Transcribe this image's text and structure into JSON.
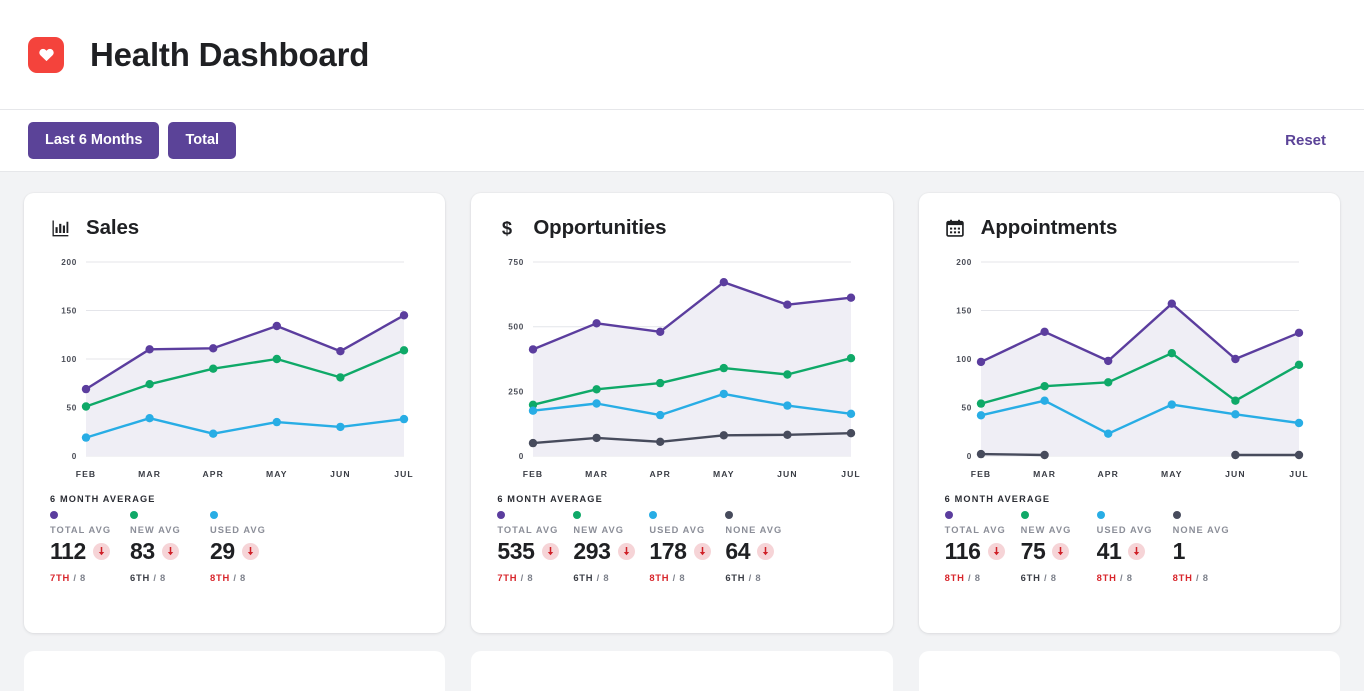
{
  "header": {
    "logo_icon": "heart-icon",
    "logo_color": "#f4433c",
    "title": "Health Dashboard"
  },
  "toolbar": {
    "filters": [
      {
        "label": "Last 6 Months",
        "active": true
      },
      {
        "label": "Total",
        "active": true
      }
    ],
    "reset_label": "Reset",
    "accent_color": "#5b4398"
  },
  "series_colors": {
    "total": "#5b3d9e",
    "new": "#0fa968",
    "used": "#28ade5",
    "none": "#474b5c"
  },
  "cards": [
    {
      "id": "sales",
      "icon": "bar-chart-icon",
      "title": "Sales",
      "stats_caption": "6 MONTH AVERAGE",
      "stats": [
        {
          "label": "TOTAL AVG",
          "value": "112",
          "color": "#5b3d9e",
          "trend": "down",
          "rank": "7TH",
          "rank_bad": true,
          "rank_total": "/ 8"
        },
        {
          "label": "NEW AVG",
          "value": "83",
          "color": "#0fa968",
          "trend": "down",
          "rank": "6TH",
          "rank_bad": false,
          "rank_total": "/ 8"
        },
        {
          "label": "USED AVG",
          "value": "29",
          "color": "#28ade5",
          "trend": "down",
          "rank": "8TH",
          "rank_bad": true,
          "rank_total": "/ 8"
        }
      ],
      "chart_data": {
        "type": "line",
        "title": "Sales",
        "xlabel": "",
        "ylabel": "",
        "x": [
          "FEB",
          "MAR",
          "APR",
          "MAY",
          "JUN",
          "JUL"
        ],
        "categories": [
          "FEB",
          "MAR",
          "APR",
          "MAY",
          "JUN",
          "JUL"
        ],
        "yticks": [
          0,
          50,
          100,
          150,
          200
        ],
        "ylim": [
          0,
          200
        ],
        "grid": true,
        "legend": "bottom",
        "series": [
          {
            "name": "TOTAL AVG",
            "color": "#5b3d9e",
            "values": [
              69,
              110,
              111,
              134,
              108,
              145
            ]
          },
          {
            "name": "NEW AVG",
            "color": "#0fa968",
            "values": [
              51,
              74,
              90,
              100,
              81,
              109
            ]
          },
          {
            "name": "USED AVG",
            "color": "#28ade5",
            "values": [
              19,
              39,
              23,
              35,
              30,
              38
            ]
          }
        ]
      }
    },
    {
      "id": "opportunities",
      "icon": "dollar-icon",
      "title": "Opportunities",
      "stats_caption": "6 MONTH AVERAGE",
      "stats": [
        {
          "label": "TOTAL AVG",
          "value": "535",
          "color": "#5b3d9e",
          "trend": "down",
          "rank": "7TH",
          "rank_bad": true,
          "rank_total": "/ 8"
        },
        {
          "label": "NEW AVG",
          "value": "293",
          "color": "#0fa968",
          "trend": "down",
          "rank": "6TH",
          "rank_bad": false,
          "rank_total": "/ 8"
        },
        {
          "label": "USED AVG",
          "value": "178",
          "color": "#28ade5",
          "trend": "down",
          "rank": "8TH",
          "rank_bad": true,
          "rank_total": "/ 8"
        },
        {
          "label": "NONE AVG",
          "value": "64",
          "color": "#474b5c",
          "trend": "down",
          "rank": "6TH",
          "rank_bad": false,
          "rank_total": "/ 8"
        }
      ],
      "chart_data": {
        "type": "line",
        "title": "Opportunities",
        "xlabel": "",
        "ylabel": "",
        "x": [
          "FEB",
          "MAR",
          "APR",
          "MAY",
          "JUN",
          "JUL"
        ],
        "categories": [
          "FEB",
          "MAR",
          "APR",
          "MAY",
          "JUN",
          "JUL"
        ],
        "yticks": [
          0,
          250,
          500,
          750
        ],
        "ylim": [
          0,
          750
        ],
        "grid": true,
        "legend": "bottom",
        "series": [
          {
            "name": "TOTAL AVG",
            "color": "#5b3d9e",
            "values": [
              412,
              513,
              480,
              672,
              585,
              612
            ]
          },
          {
            "name": "NEW AVG",
            "color": "#0fa968",
            "values": [
              198,
              258,
              282,
              340,
              315,
              378
            ]
          },
          {
            "name": "USED AVG",
            "color": "#28ade5",
            "values": [
              175,
              203,
              158,
              240,
              195,
              163
            ]
          },
          {
            "name": "NONE AVG",
            "color": "#474b5c",
            "values": [
              50,
              70,
              55,
              80,
              82,
              88
            ]
          }
        ]
      }
    },
    {
      "id": "appointments",
      "icon": "calendar-icon",
      "title": "Appointments",
      "stats_caption": "6 MONTH AVERAGE",
      "stats": [
        {
          "label": "TOTAL AVG",
          "value": "116",
          "color": "#5b3d9e",
          "trend": "down",
          "rank": "8TH",
          "rank_bad": true,
          "rank_total": "/ 8"
        },
        {
          "label": "NEW AVG",
          "value": "75",
          "color": "#0fa968",
          "trend": "down",
          "rank": "6TH",
          "rank_bad": false,
          "rank_total": "/ 8"
        },
        {
          "label": "USED AVG",
          "value": "41",
          "color": "#28ade5",
          "trend": "down",
          "rank": "8TH",
          "rank_bad": true,
          "rank_total": "/ 8"
        },
        {
          "label": "NONE AVG",
          "value": "1",
          "color": "#474b5c",
          "trend": "none",
          "rank": "8TH",
          "rank_bad": true,
          "rank_total": "/ 8"
        }
      ],
      "chart_data": {
        "type": "line",
        "title": "Appointments",
        "xlabel": "",
        "ylabel": "",
        "x": [
          "FEB",
          "MAR",
          "APR",
          "MAY",
          "JUN",
          "JUL"
        ],
        "categories": [
          "FEB",
          "MAR",
          "APR",
          "MAY",
          "JUN",
          "JUL"
        ],
        "yticks": [
          0,
          50,
          100,
          150,
          200
        ],
        "ylim": [
          0,
          200
        ],
        "grid": true,
        "legend": "bottom",
        "series": [
          {
            "name": "TOTAL AVG",
            "color": "#5b3d9e",
            "values": [
              97,
              128,
              98,
              157,
              100,
              127
            ]
          },
          {
            "name": "NEW AVG",
            "color": "#0fa968",
            "values": [
              54,
              72,
              76,
              106,
              57,
              94
            ]
          },
          {
            "name": "USED AVG",
            "color": "#28ade5",
            "values": [
              42,
              57,
              23,
              53,
              43,
              34
            ]
          },
          {
            "name": "NONE AVG",
            "color": "#474b5c",
            "values": [
              2,
              1,
              null,
              null,
              1,
              1
            ]
          }
        ]
      }
    }
  ]
}
